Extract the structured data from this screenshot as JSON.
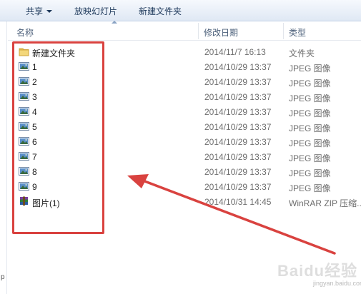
{
  "toolbar": {
    "share_label": "共享",
    "slideshow_label": "放映幻灯片",
    "new_folder_label": "新建文件夹"
  },
  "columns": {
    "name": "名称",
    "date": "修改日期",
    "type": "类型"
  },
  "files": [
    {
      "name": "新建文件夹",
      "date": "2014/11/7 16:13",
      "type": "文件夹",
      "icon": "folder-icon"
    },
    {
      "name": "1",
      "date": "2014/10/29 13:37",
      "type": "JPEG 图像",
      "icon": "jpeg-image-icon"
    },
    {
      "name": "2",
      "date": "2014/10/29 13:37",
      "type": "JPEG 图像",
      "icon": "jpeg-image-icon"
    },
    {
      "name": "3",
      "date": "2014/10/29 13:37",
      "type": "JPEG 图像",
      "icon": "jpeg-image-icon"
    },
    {
      "name": "4",
      "date": "2014/10/29 13:37",
      "type": "JPEG 图像",
      "icon": "jpeg-image-icon"
    },
    {
      "name": "5",
      "date": "2014/10/29 13:37",
      "type": "JPEG 图像",
      "icon": "jpeg-image-icon"
    },
    {
      "name": "6",
      "date": "2014/10/29 13:37",
      "type": "JPEG 图像",
      "icon": "jpeg-image-icon"
    },
    {
      "name": "7",
      "date": "2014/10/29 13:37",
      "type": "JPEG 图像",
      "icon": "jpeg-image-icon"
    },
    {
      "name": "8",
      "date": "2014/10/29 13:37",
      "type": "JPEG 图像",
      "icon": "jpeg-image-icon"
    },
    {
      "name": "9",
      "date": "2014/10/29 13:37",
      "type": "JPEG 图像",
      "icon": "jpeg-image-icon"
    },
    {
      "name": "图片(1)",
      "date": "2014/10/31 14:45",
      "type": "WinRAR ZIP 压缩...",
      "icon": "winrar-archive-icon"
    }
  ],
  "annotation": {
    "highlight_color": "#d9423f"
  },
  "nav": {
    "mark": "p"
  },
  "watermark": {
    "text": "Baidu经验",
    "sub": "jingyan.baidu.com"
  }
}
